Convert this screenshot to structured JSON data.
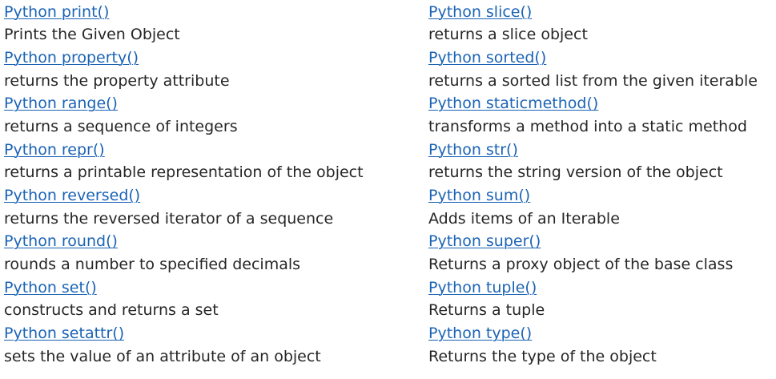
{
  "left_column": [
    {
      "link": "Python print()",
      "desc": "Prints the Given Object"
    },
    {
      "link": "Python property()",
      "desc": "returns the property attribute"
    },
    {
      "link": "Python range()",
      "desc": "returns a sequence of integers"
    },
    {
      "link": "Python repr()",
      "desc": "returns a printable representation of the object"
    },
    {
      "link": "Python reversed()",
      "desc": "returns the reversed iterator of a sequence"
    },
    {
      "link": "Python round()",
      "desc": "rounds a number to specified decimals"
    },
    {
      "link": "Python set()",
      "desc": "constructs and returns a set"
    },
    {
      "link": "Python setattr()",
      "desc": "sets the value of an attribute of an object"
    }
  ],
  "right_column": [
    {
      "link": "Python slice()",
      "desc": "returns a slice object"
    },
    {
      "link": "Python sorted()",
      "desc": "returns a sorted list from the given iterable"
    },
    {
      "link": "Python staticmethod()",
      "desc": "transforms a method into a static method"
    },
    {
      "link": "Python str()",
      "desc": "returns the string version of the object"
    },
    {
      "link": "Python sum()",
      "desc": "Adds items of an Iterable"
    },
    {
      "link": "Python super()",
      "desc": "Returns a proxy object of the base class"
    },
    {
      "link": "Python tuple()",
      "desc": "Returns a tuple"
    },
    {
      "link": "Python type()",
      "desc": "Returns the type of the object"
    }
  ],
  "colors": {
    "link": "#1a63b5",
    "text": "#262626",
    "background": "#ffffff"
  }
}
